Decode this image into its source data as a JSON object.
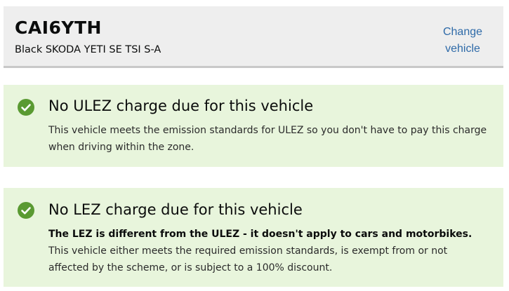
{
  "vehicle": {
    "registration": "CAI6YTH",
    "description": "Black SKODA YETI SE TSI S-A",
    "change_link": {
      "line1": "Change",
      "line2": "vehicle"
    }
  },
  "ulez": {
    "icon": "check-circle-icon",
    "title": "No ULEZ charge due for this vehicle",
    "body": "This vehicle meets the emission standards for ULEZ so you don't have to pay this charge when driving within the zone."
  },
  "lez": {
    "icon": "check-circle-icon",
    "title": "No LEZ charge due for this vehicle",
    "body_bold": "The LEZ is different from the ULEZ - it doesn't apply to cars and motorbikes.",
    "body_rest": " This vehicle either meets the required emission standards, is exempt from or not affected by the scheme, or is subject to a 100% discount."
  },
  "colors": {
    "success_green": "#5a9a32",
    "panel_background": "#e8f5dc",
    "vehicle_box_background": "#eeeeee",
    "link": "#2e6aa8"
  }
}
